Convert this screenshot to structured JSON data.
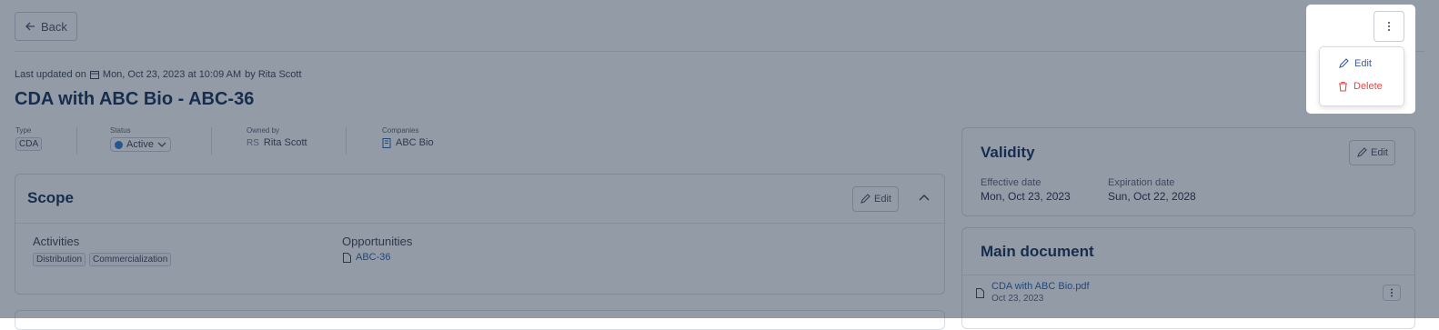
{
  "toolbar": {
    "back_label": "Back"
  },
  "header": {
    "updated_prefix": "Last updated on",
    "updated_date": "Mon, Oct 23, 2023 at 10:09 AM",
    "updated_by": "by Rita Scott",
    "title": "CDA with ABC Bio - ABC-36"
  },
  "meta": {
    "type_label": "Type",
    "type_value": "CDA",
    "status_label": "Status",
    "status_value": "Active",
    "owner_label": "Owned by",
    "owner_initials": "RS",
    "owner_name": "Rita Scott",
    "companies_label": "Companies",
    "company_name": "ABC Bio"
  },
  "scope": {
    "title": "Scope",
    "edit_label": "Edit",
    "activities_label": "Activities",
    "activities": [
      "Distribution",
      "Commercialization"
    ],
    "opportunities_label": "Opportunities",
    "opportunity": "ABC-36"
  },
  "validity": {
    "title": "Validity",
    "edit_label": "Edit",
    "effective_label": "Effective date",
    "effective_value": "Mon, Oct 23, 2023",
    "expiration_label": "Expiration date",
    "expiration_value": "Sun, Oct 22, 2028"
  },
  "main_document": {
    "title": "Main document",
    "file_name": "CDA with ABC Bio.pdf",
    "file_date": "Oct 23, 2023"
  },
  "menu": {
    "edit_label": "Edit",
    "delete_label": "Delete"
  },
  "colors": {
    "overlay": "#1e2d46",
    "delete": "#e04848",
    "brand_title": "#132c56",
    "link": "#2a5fb4"
  }
}
